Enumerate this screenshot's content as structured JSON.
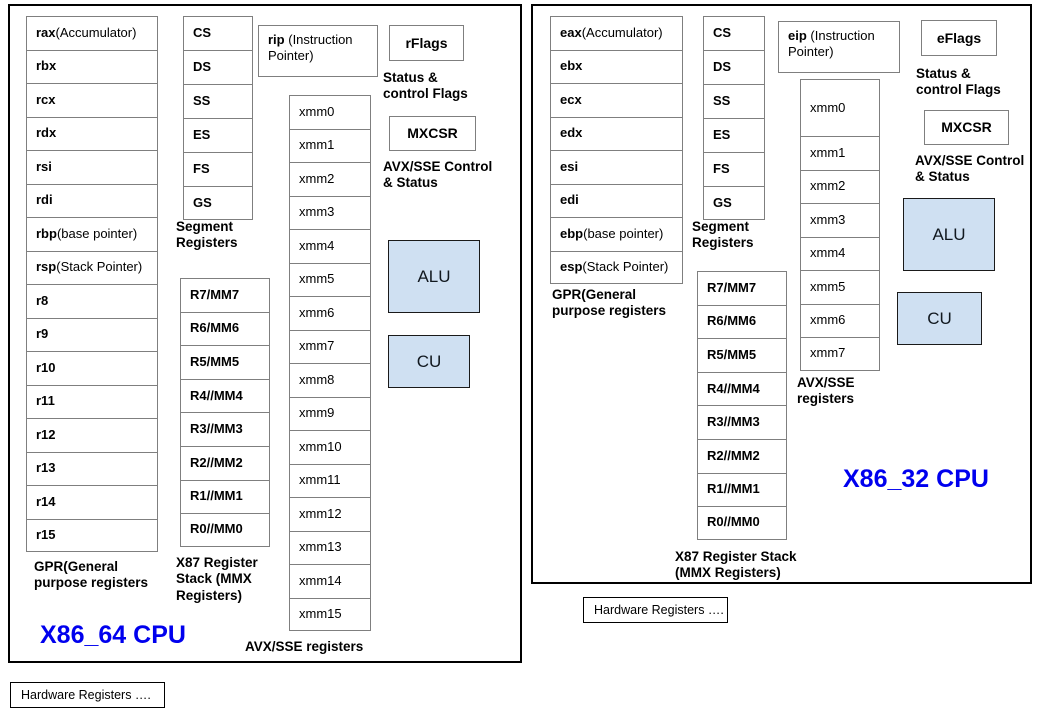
{
  "diagram": {
    "title_left": "X86_64 CPU",
    "title_right": "X86_32 CPU"
  },
  "x86_64": {
    "gpr": {
      "caption": "GPR(General\npurpose registers",
      "rows": [
        {
          "name": "rax",
          "note": " (Accumulator)"
        },
        {
          "name": "rbx",
          "note": ""
        },
        {
          "name": "rcx",
          "note": ""
        },
        {
          "name": "rdx",
          "note": ""
        },
        {
          "name": "rsi",
          "note": ""
        },
        {
          "name": "rdi",
          "note": ""
        },
        {
          "name": "rbp",
          "note": " (base pointer)"
        },
        {
          "name": "rsp",
          "note": " (Stack Pointer)"
        },
        {
          "name": "r8",
          "note": ""
        },
        {
          "name": "r9",
          "note": ""
        },
        {
          "name": "r10",
          "note": ""
        },
        {
          "name": "r11",
          "note": ""
        },
        {
          "name": "r12",
          "note": ""
        },
        {
          "name": "r13",
          "note": ""
        },
        {
          "name": "r14",
          "note": ""
        },
        {
          "name": "r15",
          "note": ""
        }
      ]
    },
    "segment": {
      "caption": "Segment\nRegisters",
      "rows": [
        "CS",
        "DS",
        "SS",
        "ES",
        "FS",
        "GS"
      ]
    },
    "x87": {
      "caption": "X87 Register\nStack (MMX\nRegisters)",
      "rows": [
        "R7/MM7",
        "R6/MM6",
        "R5/MM5",
        "R4//MM4",
        "R3//MM3",
        "R2//MM2",
        "R1//MM1",
        "R0//MM0"
      ]
    },
    "instruction_pointer": {
      "name": "rip",
      "note": " (Instruction Pointer)"
    },
    "avx": {
      "caption": "AVX/SSE registers",
      "rows": [
        "xmm0",
        "xmm1",
        "xmm2",
        "xmm3",
        "xmm4",
        "xmm5",
        "xmm6",
        "xmm7",
        "xmm8",
        "xmm9",
        "xmm10",
        "xmm11",
        "xmm12",
        "xmm13",
        "xmm14",
        "xmm15"
      ]
    },
    "flags": {
      "label": "rFlags",
      "caption": "Status &\ncontrol Flags"
    },
    "mxcsr": {
      "label": "MXCSR",
      "caption": "AVX/SSE Control\n& Status"
    },
    "alu": "ALU",
    "cu": "CU"
  },
  "x86_32": {
    "gpr": {
      "caption": "GPR(General\npurpose registers",
      "rows": [
        {
          "name": "eax",
          "note": " (Accumulator)"
        },
        {
          "name": "ebx",
          "note": ""
        },
        {
          "name": "ecx",
          "note": ""
        },
        {
          "name": "edx",
          "note": ""
        },
        {
          "name": "esi",
          "note": ""
        },
        {
          "name": "edi",
          "note": ""
        },
        {
          "name": "ebp",
          "note": " (base pointer)"
        },
        {
          "name": "esp",
          "note": " (Stack Pointer)"
        }
      ]
    },
    "segment": {
      "caption": "Segment\nRegisters",
      "rows": [
        "CS",
        "DS",
        "SS",
        "ES",
        "FS",
        "GS"
      ]
    },
    "x87": {
      "caption": "X87 Register Stack\n(MMX Registers)",
      "rows": [
        "R7/MM7",
        "R6/MM6",
        "R5/MM5",
        "R4//MM4",
        "R3//MM3",
        "R2//MM2",
        "R1//MM1",
        "R0//MM0"
      ]
    },
    "instruction_pointer": {
      "name": "eip",
      "note": " (Instruction Pointer)"
    },
    "avx": {
      "caption": "AVX/SSE\nregisters",
      "rows": [
        "xmm0",
        "xmm1",
        "xmm2",
        "xmm3",
        "xmm4",
        "xmm5",
        "xmm6",
        "xmm7"
      ]
    },
    "flags": {
      "label": "eFlags",
      "caption": "Status &\ncontrol Flags"
    },
    "mxcsr": {
      "label": "MXCSR",
      "caption": "AVX/SSE Control\n& Status"
    },
    "alu": "ALU",
    "cu": "CU"
  },
  "legend": {
    "hardware_registers_right": "Hardware Registers ….",
    "hardware_registers_bottom": "Hardware Registers …."
  },
  "colors": {
    "unit_fill": "#cfe0f2",
    "title": "#0000ee",
    "cell_border": "#7f7f7f",
    "panel_border": "#000000"
  }
}
